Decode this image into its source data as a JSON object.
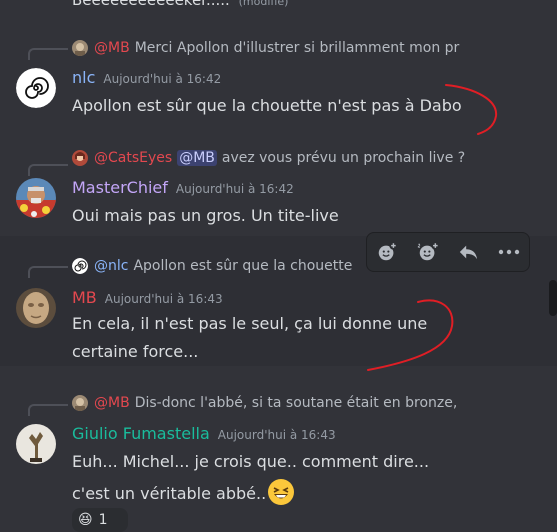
{
  "colors": {
    "background": "#323339",
    "mention_accent": "#5865f2",
    "annotation_red": "#e01e25"
  },
  "top_partial": {
    "text": "Beeeeeeeeeeeker.....",
    "edited": "(modifié)"
  },
  "messages": [
    {
      "reply": {
        "author": "@MB",
        "text": "Merci Apollon d'illustrer si brillamment mon pr"
      },
      "author": "nlc",
      "author_color": "#8ab4f8",
      "avatar_icon": "spiral-icon",
      "timestamp": "Aujourd'hui à 16:42",
      "lines": [
        "Apollon est sûr que la chouette n'est pas à Dabo"
      ]
    },
    {
      "reply": {
        "author": "@CatsEyes",
        "mention": "@MB",
        "text": "avez vous prévu un prochain live ?"
      },
      "author": "MasterChief",
      "author_color": "#c3a6f7",
      "timestamp": "Aujourd'hui à 16:42",
      "lines": [
        "Oui mais pas un gros. Un tite-live"
      ]
    },
    {
      "reply": {
        "author": "@nlc",
        "text": "Apollon est sûr que la chouette"
      },
      "author": "MB",
      "author_color": "#e3484f",
      "timestamp": "Aujourd'hui à 16:43",
      "lines": [
        "En cela, il n'est pas le seul, ça lui donne une",
        "certaine force..."
      ]
    },
    {
      "reply": {
        "author": "@MB",
        "text": "Dis-donc l'abbé, si ta soutane était en bronze,"
      },
      "author": "Giulio Fumastella",
      "author_color": "#1abc9c",
      "timestamp": "Aujourd'hui à 16:43",
      "lines": [
        "Euh... Michel... je crois que.. comment dire...",
        "c'est un véritable abbé.."
      ],
      "reaction": {
        "emoji": "😆",
        "count": "1"
      }
    }
  ],
  "toolbar": {
    "items": [
      "add-reaction-icon",
      "super-reaction-icon",
      "reply-icon",
      "more-icon"
    ]
  }
}
